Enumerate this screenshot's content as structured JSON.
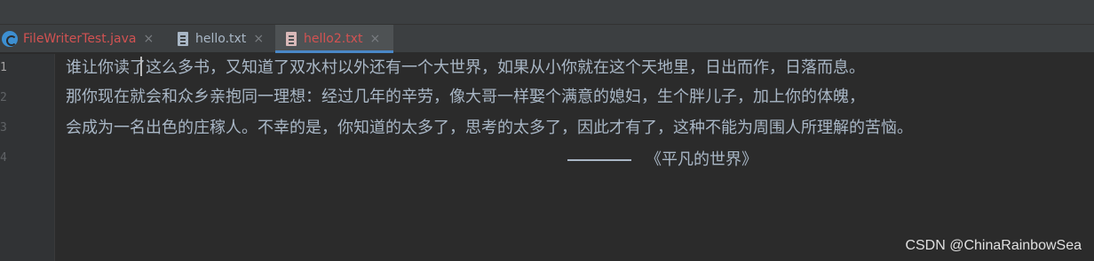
{
  "tabs": [
    {
      "label": "FileWriterTest.java",
      "close": "×",
      "icon": "java-class-icon",
      "active": false
    },
    {
      "label": "hello.txt",
      "close": "×",
      "icon": "text-file-icon",
      "active": false
    },
    {
      "label": "hello2.txt",
      "close": "×",
      "icon": "text-file-icon",
      "active": true
    }
  ],
  "gutter": {
    "line_numbers": [
      "1",
      "2",
      "3",
      "4"
    ]
  },
  "editor": {
    "lines": [
      "谁让你读了这么多书，又知道了双水村以外还有一个大世界，如果从小你就在这个天地里，日出而作，日落而息。",
      "那你现在就会和众乡亲抱同一理想：经过几年的辛劳，像大哥一样娶个满意的媳妇，生个胖儿子，加上你的体魄，",
      "会成为一名出色的庄稼人。不幸的是，你知道的太多了，思考的太多了，因此才有了，这种不能为周围人所理解的苦恼。",
      "《平凡的世界》"
    ]
  },
  "watermark": "CSDN @ChinaRainbowSea",
  "colors": {
    "background": "#2b2b2b",
    "tabbar": "#3c3f41",
    "active_tab": "#4e5254",
    "accent": "#4a88c7",
    "text": "#a9b7c6",
    "modified_tab_text": "#d25252"
  }
}
